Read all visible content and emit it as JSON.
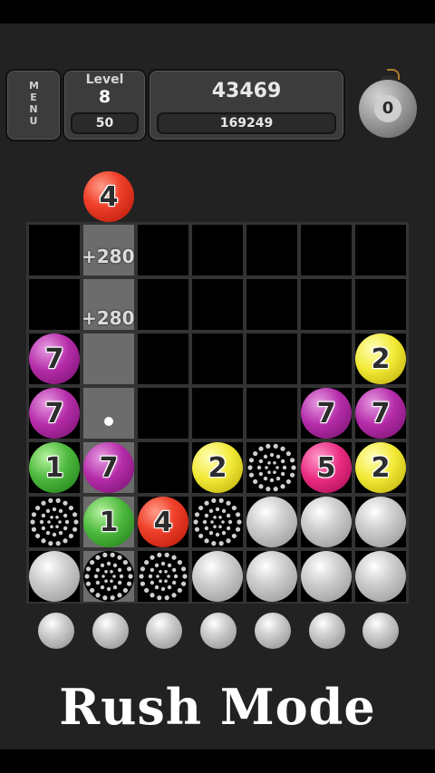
{
  "header": {
    "menu_label": "MENU",
    "level_label": "Level",
    "level_value": "8",
    "level_target": "50",
    "score": "43469",
    "best_score": "169249",
    "bomb_count": "0"
  },
  "drop_ball": {
    "number": "4",
    "color": "red"
  },
  "score_popups": [
    "+280",
    "+280"
  ],
  "board": {
    "columns": 7,
    "rows": 7,
    "highlight_column": 2,
    "pieces": [
      {
        "row": 3,
        "col": 1,
        "type": "number",
        "color": "purple",
        "label": "7"
      },
      {
        "row": 3,
        "col": 7,
        "type": "number",
        "color": "yellow",
        "label": "2"
      },
      {
        "row": 4,
        "col": 1,
        "type": "number",
        "color": "purple",
        "label": "7"
      },
      {
        "row": 4,
        "col": 6,
        "type": "number",
        "color": "purple",
        "label": "7"
      },
      {
        "row": 4,
        "col": 7,
        "type": "number",
        "color": "purple",
        "label": "7"
      },
      {
        "row": 5,
        "col": 1,
        "type": "number",
        "color": "green",
        "label": "1"
      },
      {
        "row": 5,
        "col": 2,
        "type": "number",
        "color": "purple",
        "label": "7"
      },
      {
        "row": 5,
        "col": 4,
        "type": "number",
        "color": "yellow",
        "label": "2"
      },
      {
        "row": 5,
        "col": 5,
        "type": "cracked"
      },
      {
        "row": 5,
        "col": 6,
        "type": "number",
        "color": "magenta",
        "label": "5"
      },
      {
        "row": 5,
        "col": 7,
        "type": "number",
        "color": "yellow",
        "label": "2"
      },
      {
        "row": 6,
        "col": 1,
        "type": "cracked"
      },
      {
        "row": 6,
        "col": 2,
        "type": "number",
        "color": "green",
        "label": "1"
      },
      {
        "row": 6,
        "col": 3,
        "type": "number",
        "color": "red",
        "label": "4"
      },
      {
        "row": 6,
        "col": 4,
        "type": "cracked"
      },
      {
        "row": 6,
        "col": 5,
        "type": "blank"
      },
      {
        "row": 6,
        "col": 6,
        "type": "blank"
      },
      {
        "row": 6,
        "col": 7,
        "type": "blank"
      },
      {
        "row": 7,
        "col": 1,
        "type": "blank"
      },
      {
        "row": 7,
        "col": 2,
        "type": "cracked"
      },
      {
        "row": 7,
        "col": 3,
        "type": "cracked"
      },
      {
        "row": 7,
        "col": 4,
        "type": "blank"
      },
      {
        "row": 7,
        "col": 5,
        "type": "blank"
      },
      {
        "row": 7,
        "col": 6,
        "type": "blank"
      },
      {
        "row": 7,
        "col": 7,
        "type": "blank"
      }
    ]
  },
  "incoming_row_count": 7,
  "mode_title": "Rush Mode",
  "colors": {
    "red": "#f0402a",
    "purple": "#b52ca9",
    "yellow": "#f2ea36",
    "green": "#4cb83c",
    "magenta": "#ea2c82",
    "gray": "#d2d2d2",
    "background": "#222222"
  }
}
